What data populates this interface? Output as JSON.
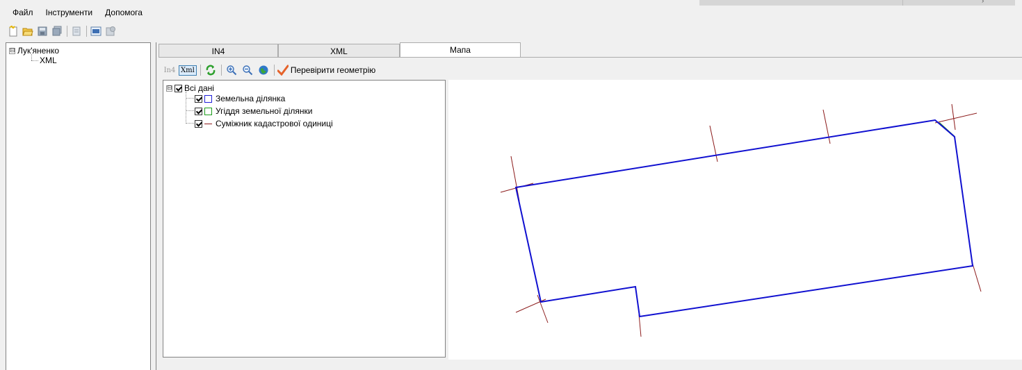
{
  "menu": {
    "items": [
      "Файл",
      "Інструменти",
      "Допомога"
    ]
  },
  "toolbar": {
    "icons": [
      "new-file-icon",
      "open-folder-icon",
      "save-icon",
      "save-all-icon",
      "document-icon",
      "xml-export-icon",
      "xml-import-icon"
    ]
  },
  "tree": {
    "root": "Лук'яненко",
    "child": "XML",
    "expander": "⊟"
  },
  "tabs": [
    {
      "label": "IN4",
      "active": false
    },
    {
      "label": "XML",
      "active": false
    },
    {
      "label": "Мапа",
      "active": true
    }
  ],
  "map_toolbar": {
    "in4_label": "In4",
    "xml_label": "Xml",
    "check_geometry_label": "Перевірити геометрію"
  },
  "layers": {
    "root": "Всі дані",
    "items": [
      {
        "label": "Земельна ділянка",
        "color": "#1f1fd8",
        "symbol": "square"
      },
      {
        "label": "Угіддя земельної ділянки",
        "color": "#1a9c1a",
        "symbol": "square"
      },
      {
        "label": "Суміжник кадастрової одиниці",
        "color": "#8b1a1a",
        "symbol": "line"
      }
    ]
  },
  "colors": {
    "parcel": "#1010d0",
    "neighbor": "#8b1a1a",
    "landuse": "#1a8c1a",
    "check": "#e06020"
  }
}
